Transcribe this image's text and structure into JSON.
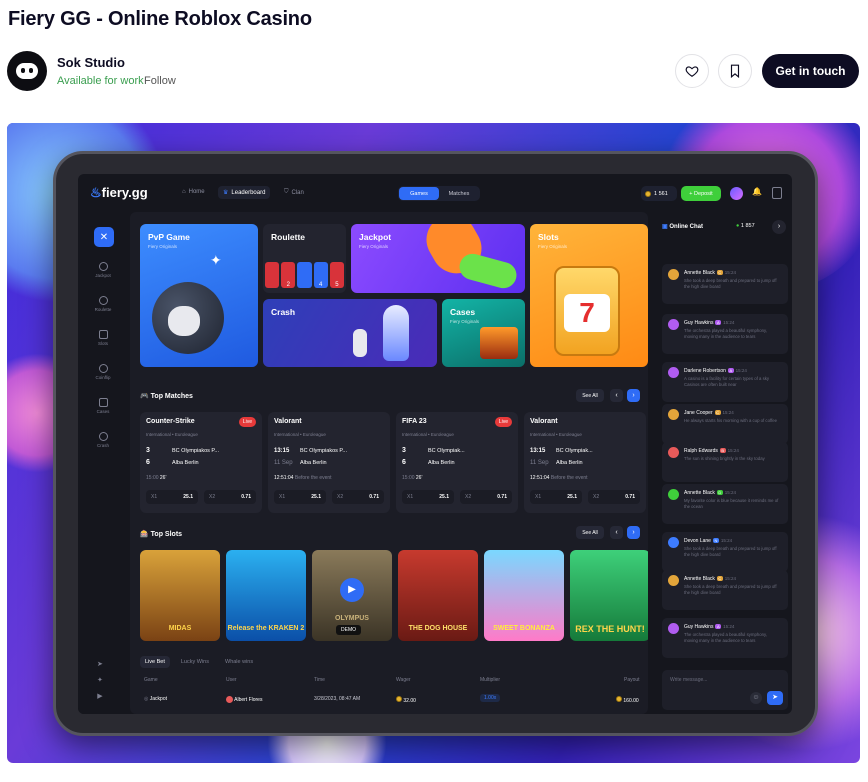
{
  "page": {
    "title": "Fiery GG - Online Roblox Casino",
    "studio": "Sok Studio",
    "availability": "Available for work",
    "follow": "Follow",
    "cta": "Get in touch"
  },
  "app": {
    "logo": "fiery.gg",
    "nav": [
      "Home",
      "Leaderboard",
      "Clan"
    ],
    "segments": [
      "Games",
      "Matches"
    ],
    "balance": "1 561",
    "deposit": "+ Deposit",
    "sidebar": [
      "Jackpot",
      "Roulette",
      "Slots",
      "Coinflip",
      "Cases",
      "Crash"
    ],
    "cards": [
      {
        "title": "PvP Game",
        "sub": "Fiery Originals"
      },
      {
        "title": "Roulette",
        "sub": ""
      },
      {
        "title": "Jackpot",
        "sub": "Fiery Originals"
      },
      {
        "title": "Slots",
        "sub": "Fiery Originals"
      },
      {
        "title": "Crash",
        "sub": ""
      },
      {
        "title": "Cases",
        "sub": "Fiery Originals"
      }
    ],
    "roulette_nums": [
      "2",
      "4",
      "5"
    ],
    "top_matches": "Top Matches",
    "top_slots": "Top Slots",
    "see_all": "See All",
    "matches": [
      {
        "game": "Counter-Strike",
        "live": "Live",
        "league": "International  •  Euroleague",
        "s1": "3",
        "s2": "6",
        "t1": "BC Olympiakos P...",
        "t2": "Alba Berlin",
        "foot": "15:00",
        "foot2": "26'",
        "x1": "X1",
        "o1": "25.1",
        "x2": "X2",
        "o2": "0.71"
      },
      {
        "game": "Valorant",
        "live": "",
        "league": "International  •  Euroleague",
        "s1": "13:15",
        "s2": "11 Sep",
        "t1": "BC Olympiakos P...",
        "t2": "Alba Berlin",
        "foot": "12:51:04",
        "foot2": "Before the event",
        "x1": "X1",
        "o1": "25.1",
        "x2": "X2",
        "o2": "0.71"
      },
      {
        "game": "FIFA 23",
        "live": "Live",
        "league": "International  •  Euroleague",
        "s1": "3",
        "s2": "6",
        "t1": "BC Olympiak...",
        "t2": "Alba Berlin",
        "foot": "15:00",
        "foot2": "26'",
        "x1": "X1",
        "o1": "25.1",
        "x2": "X2",
        "o2": "0.71"
      },
      {
        "game": "Valorant",
        "live": "",
        "league": "International  •  Euroleague",
        "s1": "13:15",
        "s2": "11 Sep",
        "t1": "BC Olympiak...",
        "t2": "Alba Berlin",
        "foot": "12:51:04",
        "foot2": "Before the event",
        "x1": "X1",
        "o1": "25.1",
        "x2": "X2",
        "o2": "0.71"
      }
    ],
    "slots": [
      "MIDAS",
      "Release the KRAKEN 2",
      "OLYMPUS",
      "THE DOG HOUSE",
      "SWEET BONANZA",
      "REX THE HUNT!"
    ],
    "demo": "DEMO",
    "tabs": [
      "Live Bet",
      "Lucky Wins",
      "Whale wins"
    ],
    "table_head": [
      "Game",
      "User",
      "Time",
      "Wager",
      "Multiplier",
      "Payout"
    ],
    "table_row": [
      "Jackpot",
      "Albert Flores",
      "3/28/2023, 08:47 AM",
      "32.00",
      "1.00x",
      "160.00"
    ]
  },
  "chat": {
    "title": "Online Chat",
    "count": "1 857",
    "placeholder": "Write message...",
    "messages": [
      {
        "name": "Annette Black",
        "lvl": "C",
        "time": "15:24",
        "text": "She took a deep breath and prepared to jump off the high dive board",
        "color": "#e3a53a"
      },
      {
        "name": "Guy Hawkins",
        "lvl": "A",
        "time": "15:24",
        "text": "The orchestra played a beautiful symphony, moving many in the audience to tears",
        "color": "#b05cf0"
      },
      {
        "name": "Darlene Robertson",
        "lvl": "A",
        "time": "15:24",
        "text": "A casino is a facility for certain types of a sky Casinos are often built near",
        "color": "#b05cf0"
      },
      {
        "name": "Jane Cooper",
        "lvl": "C",
        "time": "15:24",
        "text": "He always starts his morning with a cup of coffee",
        "color": "#e3a53a"
      },
      {
        "name": "Ralph Edwards",
        "lvl": "B",
        "time": "15:24",
        "text": "The sun is shining brightly in the sky today",
        "color": "#e85a5a"
      },
      {
        "name": "Annette Black",
        "lvl": "D",
        "time": "15:24",
        "text": "My favorite color is blue because it reminds me of the ocean",
        "color": "#3fcf3b"
      },
      {
        "name": "Devon Lane",
        "lvl": "N",
        "time": "15:24",
        "text": "She took a deep breath and prepared to jump off the high dive board",
        "color": "#3d7cff"
      },
      {
        "name": "Annette Black",
        "lvl": "C",
        "time": "15:24",
        "text": "She took a deep breath and prepared to jump off the high dive board",
        "color": "#e3a53a"
      },
      {
        "name": "Guy Hawkins",
        "lvl": "A",
        "time": "15:24",
        "text": "The orchestra played a beautiful symphony, moving many in the audience to tears",
        "color": "#b05cf0"
      }
    ]
  }
}
